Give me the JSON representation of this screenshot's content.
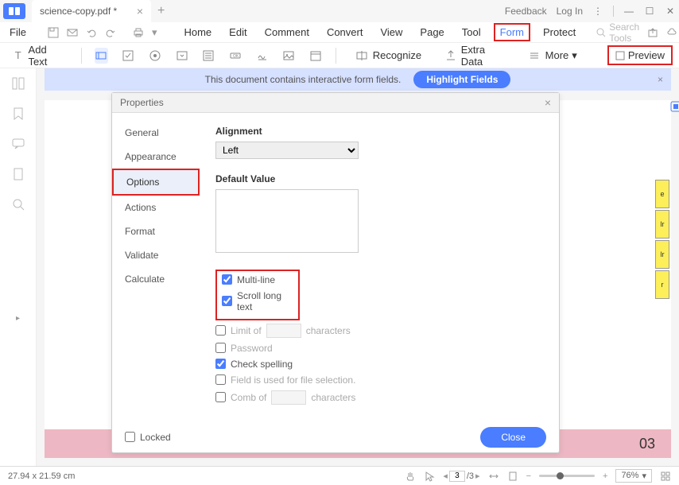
{
  "titlebar": {
    "tab_title": "science-copy.pdf *",
    "feedback": "Feedback",
    "login": "Log In"
  },
  "menubar": {
    "file": "File",
    "items": [
      "Home",
      "Edit",
      "Comment",
      "Convert",
      "View",
      "Page",
      "Tool",
      "Form",
      "Protect"
    ],
    "active_index": 7,
    "search_placeholder": "Search Tools"
  },
  "toolbar": {
    "add_text": "Add Text",
    "recognize": "Recognize",
    "extra_data": "Extra Data",
    "more": "More",
    "preview": "Preview"
  },
  "banner": {
    "message": "This document contains interactive form fields.",
    "button": "Highlight Fields"
  },
  "dialog": {
    "title": "Properties",
    "nav": [
      "General",
      "Appearance",
      "Options",
      "Actions",
      "Format",
      "Validate",
      "Calculate"
    ],
    "selected_nav_index": 2,
    "alignment_label": "Alignment",
    "alignment_value": "Left",
    "default_value_label": "Default Value",
    "default_value": "",
    "checks": {
      "multi_line": "Multi-line",
      "scroll_long": "Scroll long text",
      "limit_of": "Limit of",
      "characters": "characters",
      "password": "Password",
      "check_spelling": "Check spelling",
      "field_file": "Field is used for file selection.",
      "comb_of": "Comb of"
    },
    "locked": "Locked",
    "close": "Close"
  },
  "page": {
    "pink_number": "03",
    "yellow_cells": [
      "e",
      "lr",
      "lr",
      "r"
    ]
  },
  "statusbar": {
    "dimensions": "27.94 x 21.59 cm",
    "page_current": "3",
    "page_total": "/3",
    "zoom": "76%"
  }
}
